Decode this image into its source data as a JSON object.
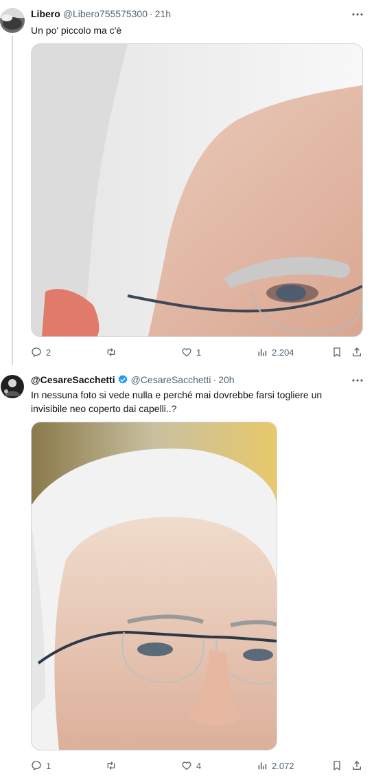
{
  "tweets": [
    {
      "name": "Libero",
      "handle": "@Libero755575300",
      "time": "21h",
      "verified": false,
      "text": "Un po' piccolo ma c'è",
      "actions": {
        "replies": "2",
        "retweets": "",
        "likes": "1",
        "views": "2.204"
      }
    },
    {
      "name": "@CesareSacchetti",
      "handle": "@CesareSacchetti",
      "time": "20h",
      "verified": true,
      "text": "In nessuna foto si vede nulla e perché mai dovrebbe farsi togliere un invisibile neo coperto dai capelli..?",
      "actions": {
        "replies": "1",
        "retweets": "",
        "likes": "4",
        "views": "2.072"
      }
    }
  ],
  "separator": "·",
  "colors": {
    "text": "#0f1419",
    "secondary": "#536471",
    "verified_blue": "#1d9bf0",
    "border": "#cfd9de"
  },
  "icons": [
    "more-icon",
    "reply-icon",
    "retweet-icon",
    "like-icon",
    "views-icon",
    "bookmark-icon",
    "share-icon",
    "verified-badge-icon"
  ]
}
